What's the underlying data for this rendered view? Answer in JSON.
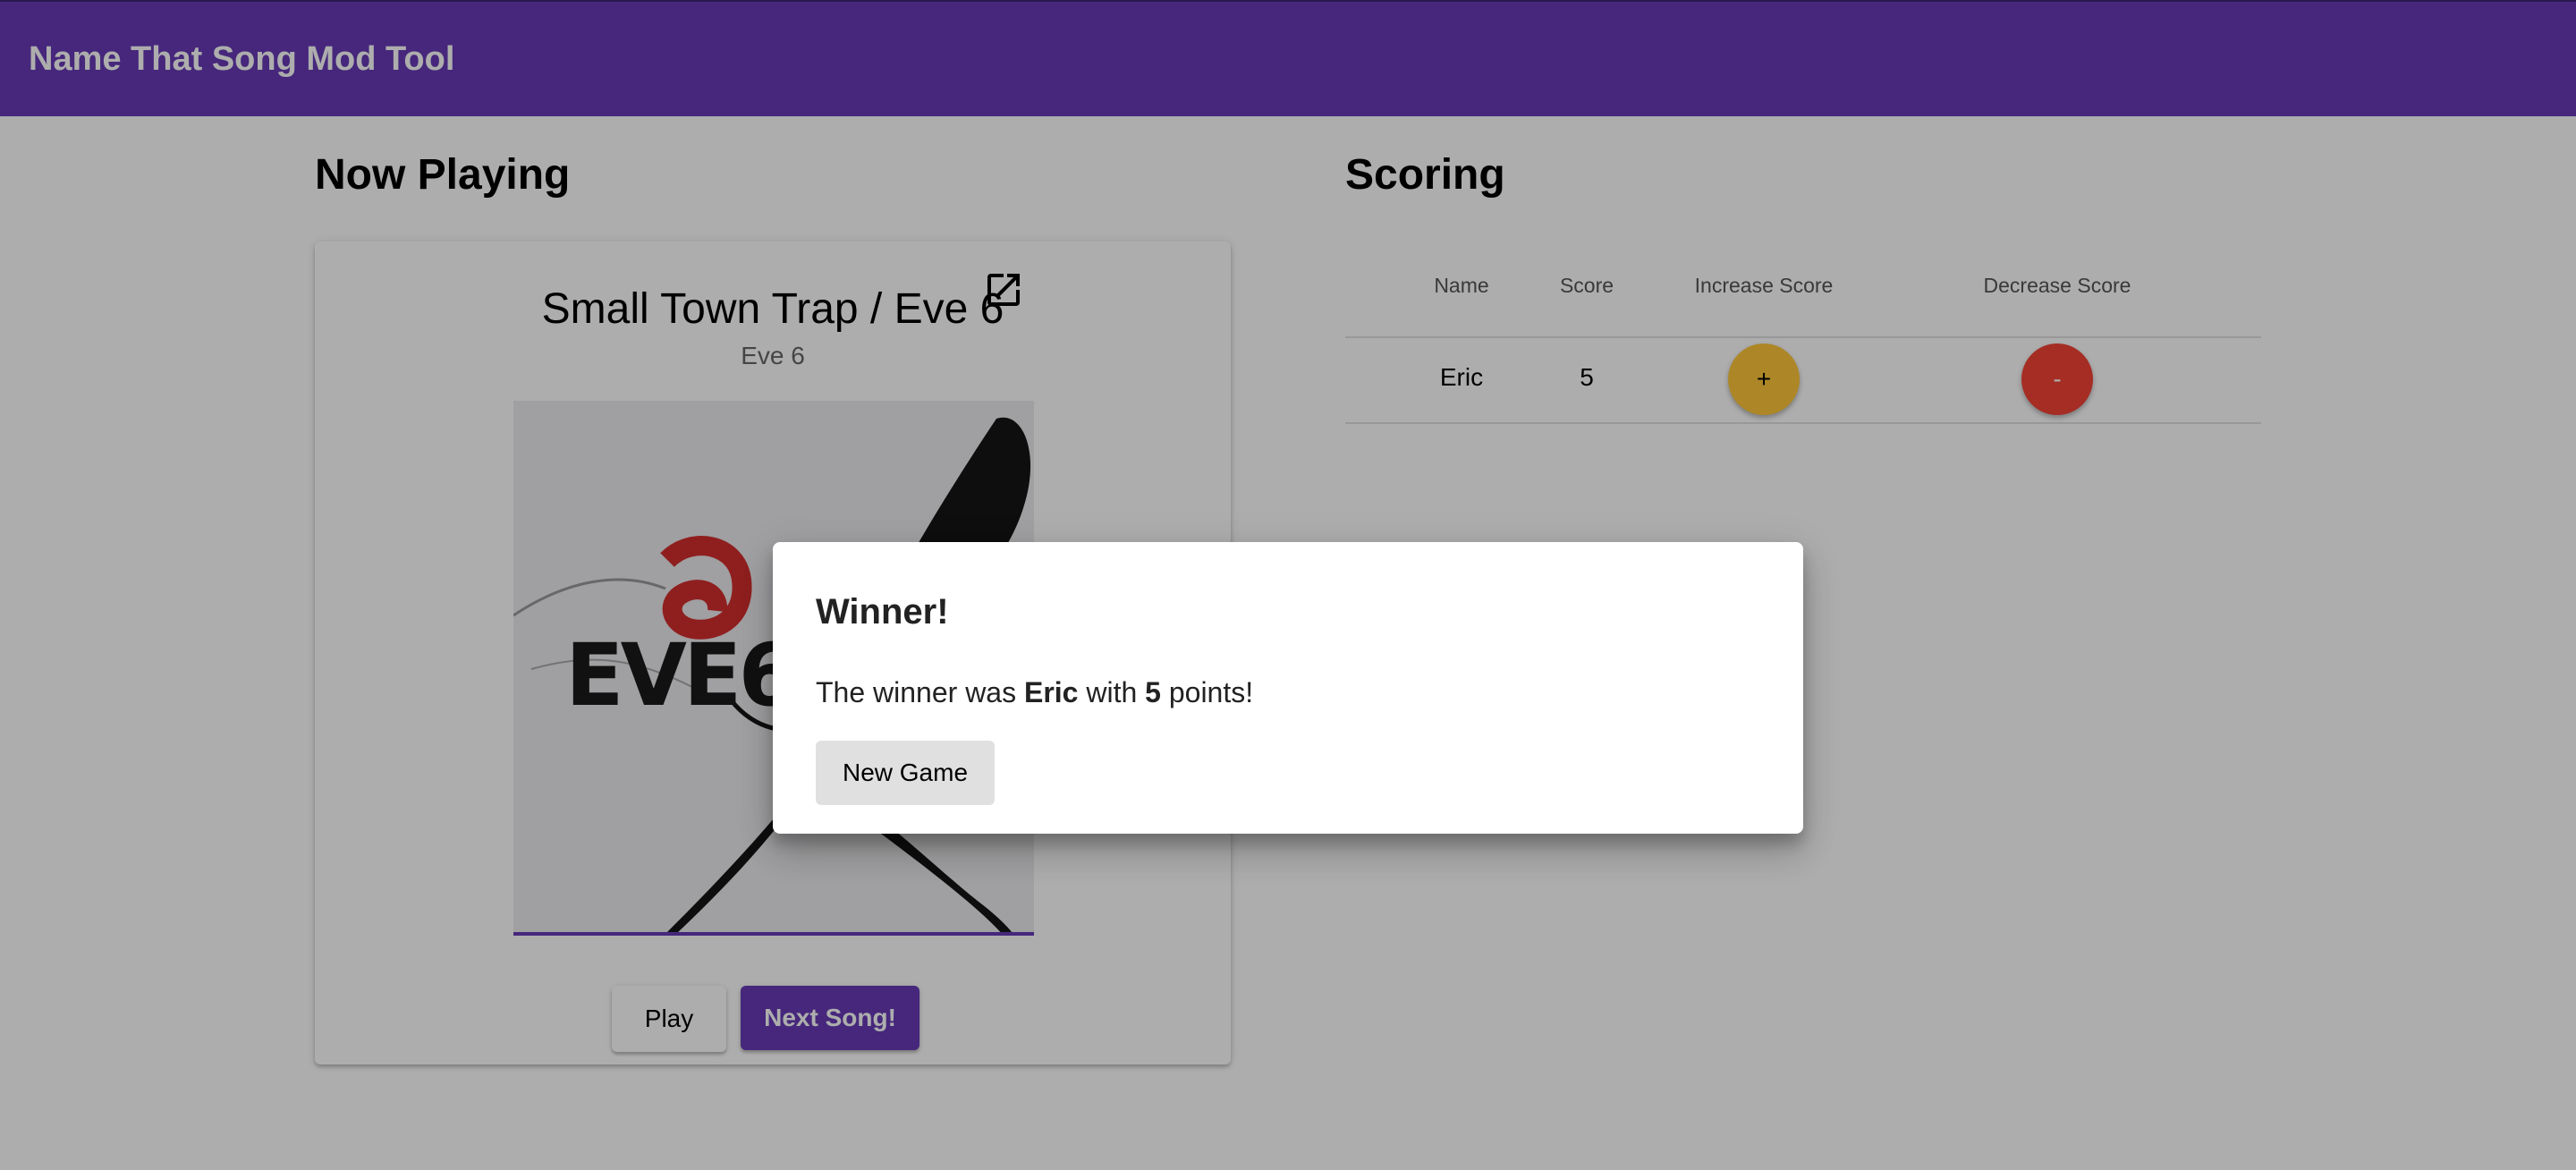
{
  "app": {
    "title": "Name That Song Mod Tool"
  },
  "now_playing": {
    "heading": "Now Playing",
    "song_title": "Small Town Trap / Eve 6",
    "artist": "Eve 6",
    "album_art_text": "EVE6",
    "play_label": "Play",
    "next_label": "Next Song!"
  },
  "scoring": {
    "heading": "Scoring",
    "columns": [
      "Name",
      "Score",
      "Increase Score",
      "Decrease Score"
    ],
    "rows": [
      {
        "name": "Eric",
        "score": "5",
        "increase_label": "+",
        "decrease_label": "-"
      }
    ]
  },
  "dialog": {
    "title": "Winner!",
    "text_prefix": "The winner was ",
    "winner_name": "Eric",
    "text_middle": " with ",
    "winner_points": "5",
    "text_suffix": " points!",
    "button_label": "New Game"
  },
  "colors": {
    "primary": "#673ab7",
    "accent": "#ffc83a",
    "warn": "#f44336"
  }
}
